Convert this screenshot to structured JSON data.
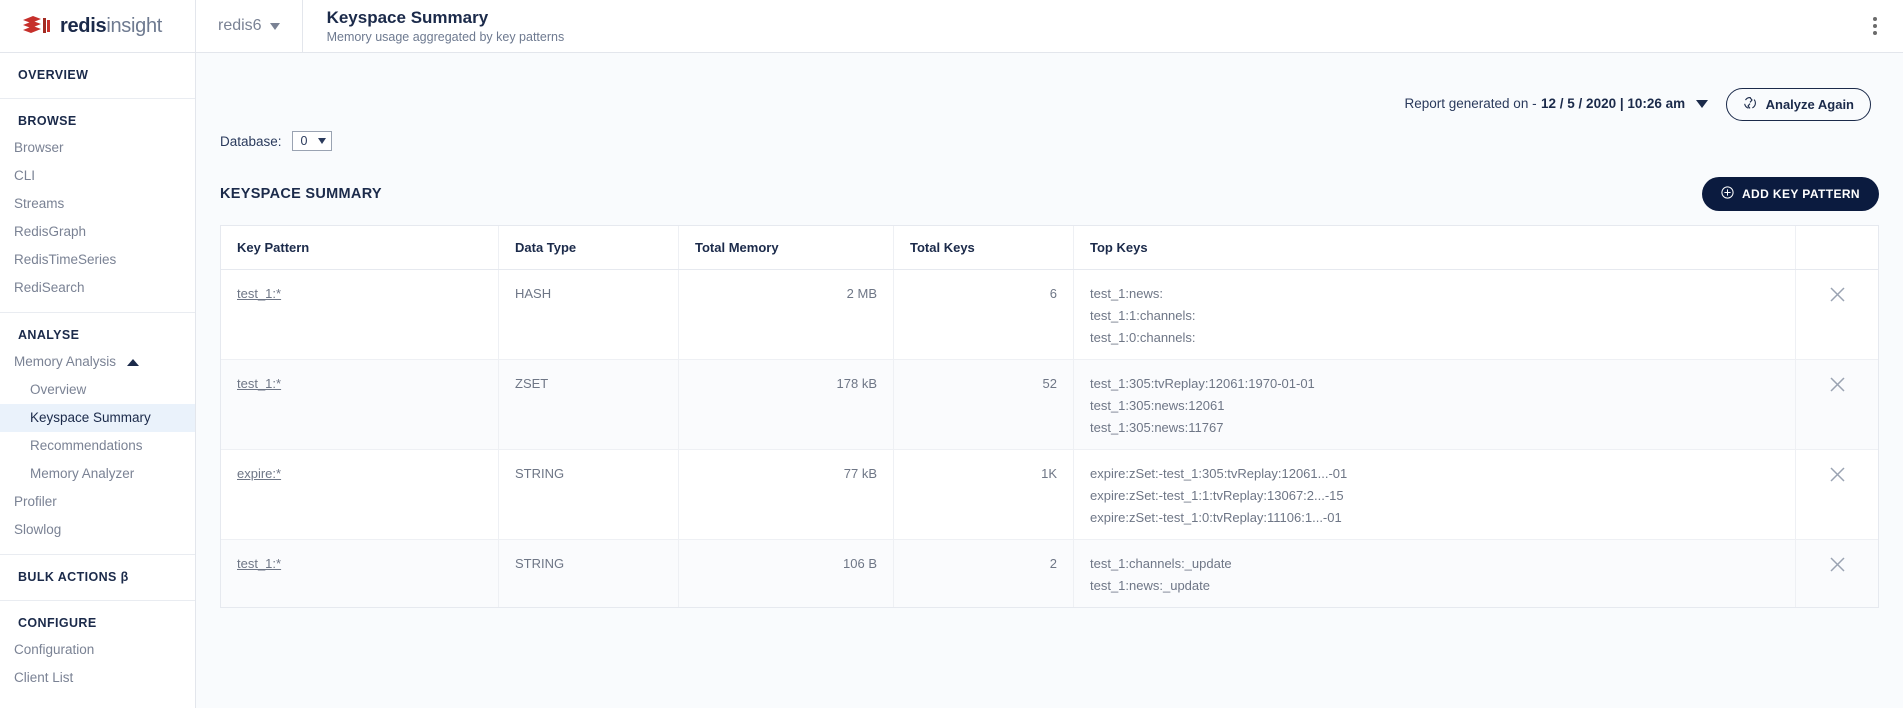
{
  "brand": {
    "bold": "redis",
    "light": "insight",
    "logo_icon": "redis-logo-icon"
  },
  "sidebar": {
    "groups": [
      {
        "head": "OVERVIEW",
        "items": []
      },
      {
        "head": "BROWSE",
        "items": [
          {
            "label": "Browser"
          },
          {
            "label": "CLI"
          },
          {
            "label": "Streams"
          },
          {
            "label": "RedisGraph"
          },
          {
            "label": "RedisTimeSeries"
          },
          {
            "label": "RediSearch"
          }
        ]
      },
      {
        "head": "ANALYSE",
        "items": [
          {
            "label": "Memory Analysis",
            "expandable": true
          },
          {
            "label": "Overview",
            "sub": true
          },
          {
            "label": "Keyspace Summary",
            "sub": true,
            "active": true
          },
          {
            "label": "Recommendations",
            "sub": true
          },
          {
            "label": "Memory Analyzer",
            "sub": true
          },
          {
            "label": "Profiler"
          },
          {
            "label": "Slowlog"
          }
        ]
      },
      {
        "head": "BULK ACTIONS  β",
        "items": []
      },
      {
        "head": "CONFIGURE",
        "items": [
          {
            "label": "Configuration"
          },
          {
            "label": "Client List"
          }
        ]
      }
    ]
  },
  "topbar": {
    "connection_name": "redis6",
    "page_title": "Keyspace Summary",
    "page_subtitle": "Memory usage aggregated by key patterns",
    "kebab_icon": "more-vertical-icon",
    "chevron_icon": "chevron-down-icon"
  },
  "report": {
    "label": "Report generated on -",
    "date": "12 / 5 / 2020 | 10:26 am",
    "analyze_label": "Analyze Again",
    "analyze_icon": "refresh-icon"
  },
  "database": {
    "label": "Database:",
    "value": "0"
  },
  "section": {
    "title": "KEYSPACE SUMMARY",
    "add_label": "ADD KEY PATTERN",
    "add_icon": "plus-circle-icon"
  },
  "table": {
    "columns": [
      "Key Pattern",
      "Data Type",
      "Total Memory",
      "Total Keys",
      "Top Keys"
    ],
    "delete_icon": "close-icon",
    "rows": [
      {
        "pattern": "test_1:*",
        "type": "HASH",
        "memory": "2 MB",
        "keys": "6",
        "top_keys": [
          "test_1:news:",
          "test_1:1:channels:",
          "test_1:0:channels:"
        ]
      },
      {
        "pattern": "test_1:*",
        "type": "ZSET",
        "memory": "178 kB",
        "keys": "52",
        "top_keys": [
          "test_1:305:tvReplay:12061:1970-01-01",
          "test_1:305:news:12061",
          "test_1:305:news:11767"
        ]
      },
      {
        "pattern": "expire:*",
        "type": "STRING",
        "memory": "77 kB",
        "keys": "1K",
        "top_keys": [
          "expire:zSet:-test_1:305:tvReplay:12061...-01",
          "expire:zSet:-test_1:1:tvReplay:13067:2...-15",
          "expire:zSet:-test_1:0:tvReplay:11106:1...-01"
        ]
      },
      {
        "pattern": "test_1:*",
        "type": "STRING",
        "memory": "106 B",
        "keys": "2",
        "top_keys": [
          "test_1:channels:_update",
          "test_1:news:_update"
        ]
      }
    ]
  },
  "colors": {
    "brand_red": "#d82c20",
    "navy": "#0b1b3f",
    "active_bg": "#eaf2fb"
  }
}
